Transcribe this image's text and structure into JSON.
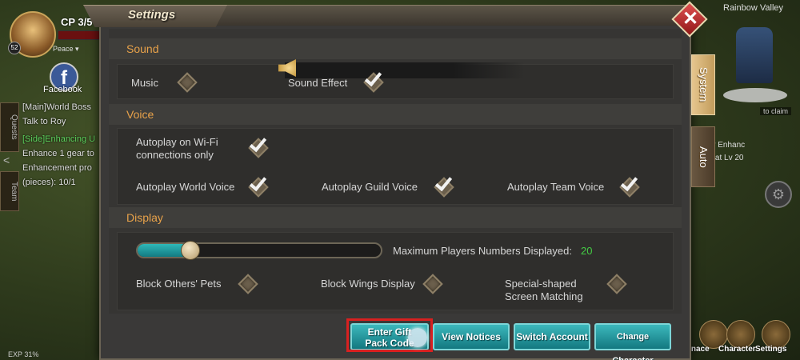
{
  "hud": {
    "cp_label": "CP 3/5",
    "level": "52",
    "status": "Peace ▾",
    "facebook_label": "Facebook",
    "tab_quests": "Quests",
    "tab_team": "Team",
    "quest_lines": [
      "[Main]World Boss",
      "Talk to Roy",
      "[Side]Enhancing U",
      "Enhance 1 gear to",
      "Enhancement pro",
      "(pieces): 10/1"
    ],
    "exp": "EXP 31%",
    "zone": "Rainbow Valley",
    "claim": "to claim",
    "gear_enhance_1": "ear Enhanc",
    "gear_enhance_2": "en at Lv 20",
    "bottom_furnace": "rnace",
    "bottom_character": "Character",
    "bottom_settings": "Settings"
  },
  "dialog": {
    "title": "Settings",
    "close_glyph": "✕",
    "side_tabs": {
      "system": "System",
      "auto": "Auto"
    },
    "sound": {
      "header": "Sound",
      "music": {
        "label": "Music",
        "checked": false
      },
      "sound_effect": {
        "label": "Sound Effect",
        "checked": true
      }
    },
    "voice": {
      "header": "Voice",
      "autoplay_wifi": {
        "label_1": "Autoplay on Wi-Fi",
        "label_2": "connections only",
        "checked": true
      },
      "autoplay_world": {
        "label": "Autoplay World Voice",
        "checked": true
      },
      "autoplay_guild": {
        "label": "Autoplay Guild Voice",
        "checked": true
      },
      "autoplay_team": {
        "label": "Autoplay Team Voice",
        "checked": true
      }
    },
    "display": {
      "header": "Display",
      "slider_fraction": 0.22,
      "max_players_label": "Maximum Players Numbers Displayed:",
      "max_players_value": "20",
      "block_pets": {
        "label": "Block Others' Pets",
        "checked": false
      },
      "block_wings": {
        "label": "Block Wings Display",
        "checked": false
      },
      "special_screen": {
        "label_1": "Special-shaped",
        "label_2": "Screen Matching",
        "checked": false
      }
    },
    "buttons": {
      "gift_1": "Enter Gift",
      "gift_2": "Pack Code",
      "view_notices": "View Notices",
      "switch_account": "Switch Account",
      "change_character": "Change Character"
    }
  },
  "colors": {
    "section_header": "#e8a24a",
    "button_teal": "#1f9aa0",
    "highlight_red": "#d82020",
    "value_green": "#44cc44"
  }
}
